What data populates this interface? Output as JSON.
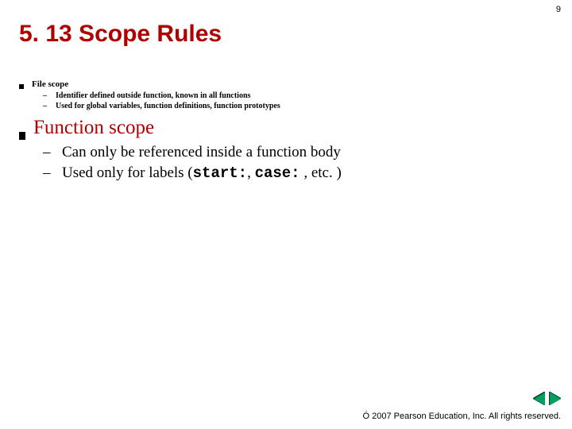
{
  "page_number": "9",
  "title": "5. 13 Scope Rules",
  "section1": {
    "heading": "File scope",
    "items": [
      "Identifier defined outside function, known in all functions",
      "Used for global variables, function definitions, function prototypes"
    ]
  },
  "section2": {
    "heading": "Function scope",
    "item1": "Can only be referenced inside a function body",
    "item2_pre": "Used only for labels (",
    "item2_code1": "start:",
    "item2_mid1": ", ",
    "item2_code2": "case:",
    "item2_mid2": " , etc. )"
  },
  "footer": "Ó 2007 Pearson Education, Inc.  All rights reserved."
}
